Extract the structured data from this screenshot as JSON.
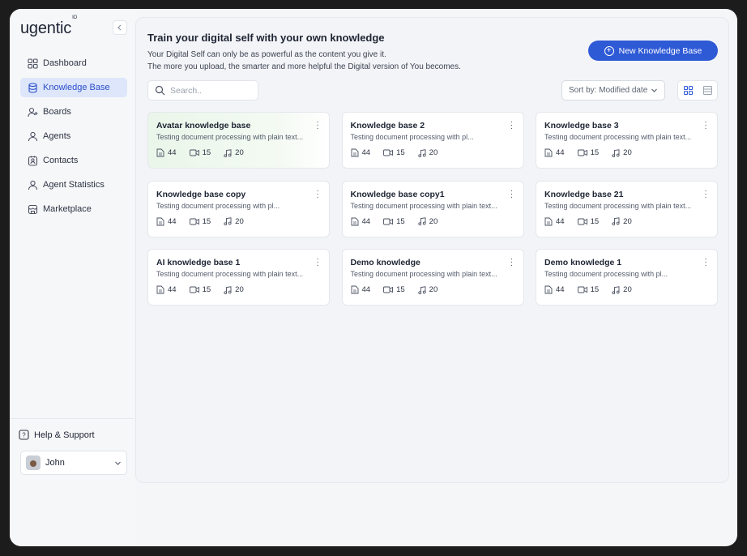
{
  "app": {
    "logo": "ugentic",
    "logo_sup": "IO"
  },
  "sidebar": {
    "items": [
      {
        "label": "Dashboard",
        "icon": "dashboard-icon",
        "active": false
      },
      {
        "label": "Knowledge Base",
        "icon": "database-icon",
        "active": true
      },
      {
        "label": "Boards",
        "icon": "boards-icon",
        "active": false
      },
      {
        "label": "Agents",
        "icon": "agents-icon",
        "active": false
      },
      {
        "label": "Contacts",
        "icon": "contacts-icon",
        "active": false
      },
      {
        "label": "Agent Statistics",
        "icon": "statistics-icon",
        "active": false
      },
      {
        "label": "Marketplace",
        "icon": "marketplace-icon",
        "active": false
      }
    ],
    "help_label": "Help & Support",
    "user_name": "John"
  },
  "main": {
    "title": "Train your digital self with your own knowledge",
    "subtitle_line1": "Your Digital Self can only be as powerful as the content you give it.",
    "subtitle_line2": "The more you upload, the smarter and more helpful the Digital version of You becomes.",
    "new_button_label": "New Knowledge Base",
    "search_placeholder": "Search..",
    "sort_label": "Sort by: Modified date"
  },
  "cards": [
    {
      "title": "Avatar knowledge base",
      "desc": "Testing document processing with plain text...",
      "docs": "44",
      "videos": "15",
      "audio": "20",
      "highlight": true
    },
    {
      "title": "Knowledge base 2",
      "desc": "Testing document processing with pl...",
      "docs": "44",
      "videos": "15",
      "audio": "20",
      "highlight": false
    },
    {
      "title": "Knowledge base 3",
      "desc": "Testing document processing with plain text...",
      "docs": "44",
      "videos": "15",
      "audio": "20",
      "highlight": false
    },
    {
      "title": "Knowledge base copy",
      "desc": "Testing document processing with pl...",
      "docs": "44",
      "videos": "15",
      "audio": "20",
      "highlight": false
    },
    {
      "title": "Knowledge base copy1",
      "desc": "Testing document processing with plain text...",
      "docs": "44",
      "videos": "15",
      "audio": "20",
      "highlight": false
    },
    {
      "title": "Knowledge base 21",
      "desc": "Testing document processing with plain text...",
      "docs": "44",
      "videos": "15",
      "audio": "20",
      "highlight": false
    },
    {
      "title": "AI knowledge base 1",
      "desc": "Testing document processing with plain text...",
      "docs": "44",
      "videos": "15",
      "audio": "20",
      "highlight": false
    },
    {
      "title": "Demo knowledge",
      "desc": "Testing document processing with plain text...",
      "docs": "44",
      "videos": "15",
      "audio": "20",
      "highlight": false
    },
    {
      "title": "Demo knowledge 1",
      "desc": "Testing document processing with pl...",
      "docs": "44",
      "videos": "15",
      "audio": "20",
      "highlight": false
    }
  ],
  "colors": {
    "accent": "#2f5ad6",
    "active_nav_bg": "#dde6fb",
    "highlight_card": "#eaf6ea"
  }
}
